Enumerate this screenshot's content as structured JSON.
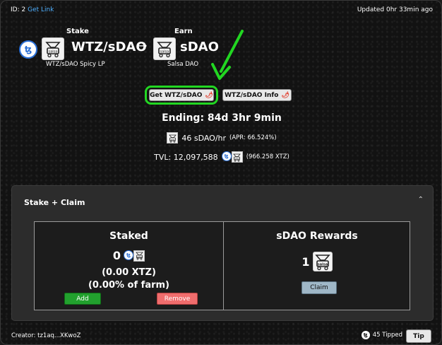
{
  "header": {
    "id_text": "ID: 2",
    "get_link": "Get Link",
    "updated": "Updated 0hr 33min ago"
  },
  "pair": {
    "stake_label": "Stake",
    "earn_label": "Earn",
    "stake_token": "WTZ/sDAO",
    "earn_token": "sDAO",
    "stake_token_name": "WTZ/sDAO Spicy LP",
    "earn_token_name": "Salsa DAO",
    "arrow": "→"
  },
  "buttons": {
    "get_token": "Get WTZ/sDAO",
    "token_info": "WTZ/sDAO Info"
  },
  "stats": {
    "ending": "Ending: 84d 3hr 9min",
    "rate": "46 sDAO/hr",
    "apr": "(APR: 66.524%)",
    "tvl": "TVL: 12,097,588",
    "tvl_xtz": "(966.258 XTZ)"
  },
  "panel": {
    "title": "Stake + Claim",
    "staked_title": "Staked",
    "staked_value": "0",
    "staked_xtz": "(0.00 XTZ)",
    "staked_farm": "(0.00% of farm)",
    "add_label": "Add",
    "remove_label": "Remove",
    "rewards_title": "sDAO Rewards",
    "rewards_value": "1",
    "claim_label": "Claim"
  },
  "footer": {
    "creator": "Creator: tz1aq...XKwoZ",
    "tipped": "45 Tipped",
    "tip_label": "Tip"
  },
  "icons": {
    "tezos": "tezos-icon",
    "salsa": "salsa-dao-token-icon",
    "chili": "chili-icon",
    "chevron": "chevron-up-icon"
  },
  "colors": {
    "accent_green": "#22d722",
    "add_button": "#22a12e",
    "remove_button": "#f06d6d",
    "claim_button": "#9fb7c7",
    "link": "#4fb0ff"
  }
}
